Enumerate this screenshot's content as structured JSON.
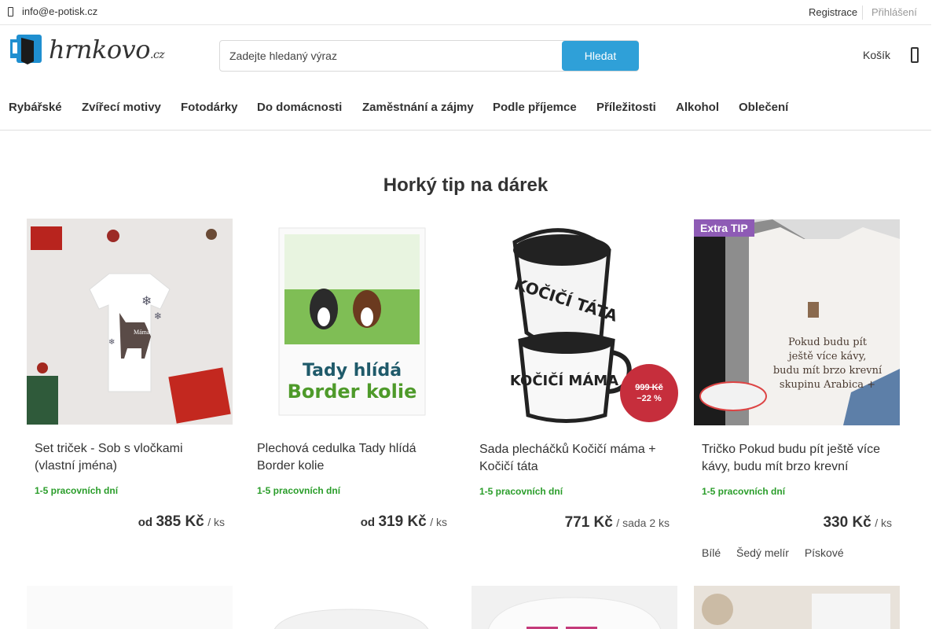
{
  "topbar": {
    "email": "info@e-potisk.cz",
    "register": "Registrace",
    "login": "Přihlášení"
  },
  "logo": {
    "name": "hrnkovo",
    "tld": ".cz"
  },
  "search": {
    "placeholder": "Zadejte hledaný výraz",
    "value": "",
    "button": "Hledat"
  },
  "cart": {
    "label": "Košík"
  },
  "nav": [
    "Rybářské",
    "Zvířecí motivy",
    "Fotodárky",
    "Do domácnosti",
    "Zaměstnání a zájmy",
    "Podle příjemce",
    "Příležitosti",
    "Alkohol",
    "Oblečení"
  ],
  "section": {
    "title": "Horký tip na dárek"
  },
  "products": [
    {
      "name": "Set triček - Sob s vločkami (vlastní jména)",
      "delivery": "1-5 pracovních dní",
      "price_prefix": "od",
      "price": "385 Kč",
      "unit": "/ ks",
      "image_text": "Máma"
    },
    {
      "name": "Plechová cedulka Tady hlídá Border kolie",
      "delivery": "1-5 pracovních dní",
      "price_prefix": "od",
      "price": "319 Kč",
      "unit": "/ ks",
      "image_text": [
        "Tady hlídá",
        "Border kolie"
      ]
    },
    {
      "name": "Sada plecháčků Kočičí máma + Kočičí táta",
      "delivery": "1-5 pracovních dní",
      "price_prefix": "",
      "price": "771 Kč",
      "unit": "/ sada 2 ks",
      "old_price": "999 Kč",
      "discount": "−22 %",
      "image_text": [
        "KOČIČÍ TÁTA",
        "KOČIČÍ MÁMA"
      ]
    },
    {
      "name": "Tričko Pokud budu pít ještě více kávy, budu mít brzo krevní",
      "delivery": "1-5 pracovních dní",
      "price_prefix": "",
      "price": "330 Kč",
      "unit": "/ ks",
      "badge": "Extra TIP",
      "variants": [
        "Bílé",
        "Šedý melír",
        "Pískové"
      ],
      "image_text": [
        "Pokud budu pít",
        "ještě více kávy,",
        "budu mít brzo krevní",
        "skupinu Arabica +"
      ]
    }
  ],
  "colors": {
    "accent": "#2fa0d8",
    "delivery_green": "#2a9d2a",
    "discount_red": "#c62e3c",
    "tip_purple": "#8e5bb5"
  }
}
